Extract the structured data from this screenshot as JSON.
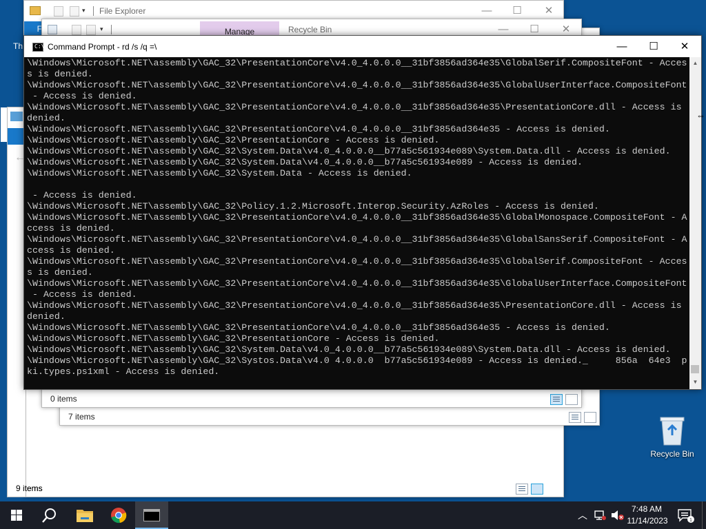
{
  "windows": {
    "explorer_back": {
      "title": "File Explorer",
      "nav_letter": "F",
      "status": "9 items"
    },
    "explorer_mid": {
      "status": "7 items"
    },
    "recycle": {
      "manage_tab": "Manage",
      "title": "Recycle Bin",
      "status": "0 items"
    }
  },
  "desktop": {
    "recycle_bin_label": "Recycle Bin",
    "partial_label": "Th"
  },
  "cmd": {
    "title": "Command Prompt - rd  /s /q =\\",
    "lines": [
      "\\Windows\\Microsoft.NET\\assembly\\GAC_32\\PresentationCore\\v4.0_4.0.0.0__31bf3856ad364e35\\GlobalSerif.CompositeFont - Acces",
      "s is denied.",
      "\\Windows\\Microsoft.NET\\assembly\\GAC_32\\PresentationCore\\v4.0_4.0.0.0__31bf3856ad364e35\\GlobalUserInterface.CompositeFont",
      " - Access is denied.",
      "\\Windows\\Microsoft.NET\\assembly\\GAC_32\\PresentationCore\\v4.0_4.0.0.0__31bf3856ad364e35\\PresentationCore.dll - Access is",
      "denied.",
      "\\Windows\\Microsoft.NET\\assembly\\GAC_32\\PresentationCore\\v4.0_4.0.0.0__31bf3856ad364e35 - Access is denied.",
      "\\Windows\\Microsoft.NET\\assembly\\GAC_32\\PresentationCore - Access is denied.",
      "\\Windows\\Microsoft.NET\\assembly\\GAC_32\\System.Data\\v4.0_4.0.0.0__b77a5c561934e089\\System.Data.dll - Access is denied.",
      "\\Windows\\Microsoft.NET\\assembly\\GAC_32\\System.Data\\v4.0_4.0.0.0__b77a5c561934e089 - Access is denied.",
      "\\Windows\\Microsoft.NET\\assembly\\GAC_32\\System.Data - Access is denied.",
      "",
      " - Access is denied.",
      "\\Windows\\Microsoft.NET\\assembly\\GAC_32\\Policy.1.2.Microsoft.Interop.Security.AzRoles - Access is denied.",
      "\\Windows\\Microsoft.NET\\assembly\\GAC_32\\PresentationCore\\v4.0_4.0.0.0__31bf3856ad364e35\\GlobalMonospace.CompositeFont - A",
      "ccess is denied.",
      "\\Windows\\Microsoft.NET\\assembly\\GAC_32\\PresentationCore\\v4.0_4.0.0.0__31bf3856ad364e35\\GlobalSansSerif.CompositeFont - A",
      "ccess is denied.",
      "\\Windows\\Microsoft.NET\\assembly\\GAC_32\\PresentationCore\\v4.0_4.0.0.0__31bf3856ad364e35\\GlobalSerif.CompositeFont - Acces",
      "s is denied.",
      "\\Windows\\Microsoft.NET\\assembly\\GAC_32\\PresentationCore\\v4.0_4.0.0.0__31bf3856ad364e35\\GlobalUserInterface.CompositeFont",
      " - Access is denied.",
      "\\Windows\\Microsoft.NET\\assembly\\GAC_32\\PresentationCore\\v4.0_4.0.0.0__31bf3856ad364e35\\PresentationCore.dll - Access is",
      "denied.",
      "\\Windows\\Microsoft.NET\\assembly\\GAC_32\\PresentationCore\\v4.0_4.0.0.0__31bf3856ad364e35 - Access is denied.",
      "\\Windows\\Microsoft.NET\\assembly\\GAC_32\\PresentationCore - Access is denied.",
      "\\Windows\\Microsoft.NET\\assembly\\GAC_32\\System.Data\\v4.0_4.0.0.0__b77a5c561934e089\\System.Data.dll - Access is denied.",
      "\\Windows\\Microsoft.NET\\assembly\\GAC_32\\Systos.Data\\v4.0 4.0.0.0  b77a5c561934e089 - Access is denied._     856a  64e3  p",
      "ki.types.ps1xml - Access is denied."
    ]
  },
  "taskbar": {
    "time": "7:48 AM",
    "date": "11/14/2023"
  },
  "icons": {
    "start": "windows-logo-icon",
    "search": "search-icon",
    "explorer": "folder-icon",
    "chrome": "chrome-icon",
    "cmd": "terminal-icon",
    "tray_chevron": "chevron-up-icon",
    "network": "network-icon",
    "volume": "volume-icon",
    "notifications": "notification-icon"
  },
  "colors": {
    "desktop": "#0b5394",
    "taskbar": "#1b1e27",
    "console_bg": "#0c0c0c",
    "console_text": "#cccccc",
    "accent": "#76b9ed"
  }
}
